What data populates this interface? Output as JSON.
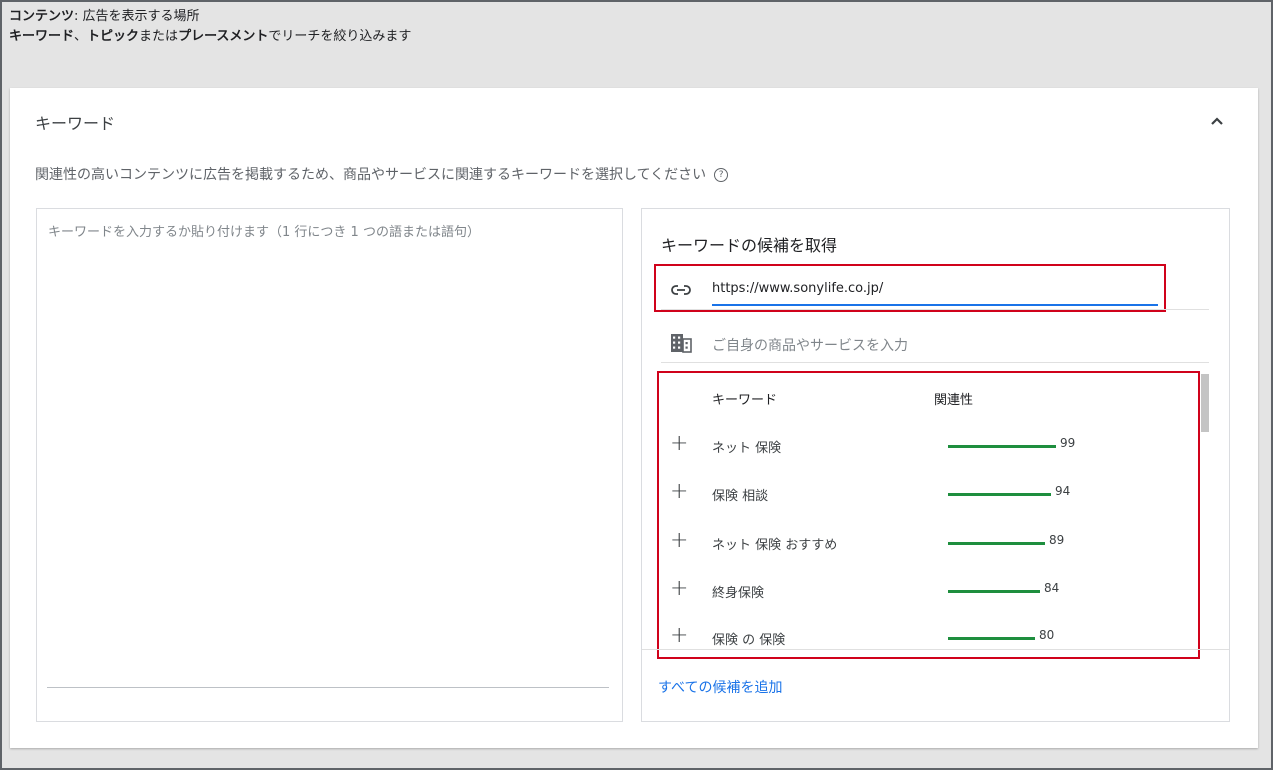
{
  "header": {
    "line1_bold": "コンテンツ",
    "line1_rest": ": 広告を表示する場所",
    "line2": [
      {
        "text": "キーワード",
        "bold": true
      },
      {
        "text": "、",
        "bold": false
      },
      {
        "text": "トピック",
        "bold": true
      },
      {
        "text": "または",
        "bold": false
      },
      {
        "text": "プレースメント",
        "bold": true
      },
      {
        "text": "でリーチを絞り込みます",
        "bold": false
      }
    ]
  },
  "card": {
    "title": "キーワード",
    "description": "関連性の高いコンテンツに広告を掲載するため、商品やサービスに関連するキーワードを選択してください",
    "help_glyph": "?",
    "keyword_input_placeholder": "キーワードを入力するか貼り付けます（1 行につき 1 つの語または語句）"
  },
  "suggestions": {
    "title": "キーワードの候補を取得",
    "url_value": "https://www.sonylife.co.jp/",
    "service_placeholder": "ご自身の商品やサービスを入力",
    "col_keyword": "キーワード",
    "col_relevance": "関連性",
    "rows": [
      {
        "keyword": "ネット 保険",
        "score": "99",
        "relevance": 99
      },
      {
        "keyword": "保険 相談",
        "score": "94",
        "relevance": 94
      },
      {
        "keyword": "ネット 保険 おすすめ",
        "score": "89",
        "relevance": 89
      },
      {
        "keyword": "終身保険",
        "score": "84",
        "relevance": 84
      },
      {
        "keyword": "保険 の 保険",
        "score": "80",
        "relevance": 80
      }
    ],
    "add_all": "すべての候補を追加"
  },
  "colors": {
    "accent": "#1a73e8",
    "bar": "#1e8e3e",
    "highlight": "#d0021b"
  }
}
